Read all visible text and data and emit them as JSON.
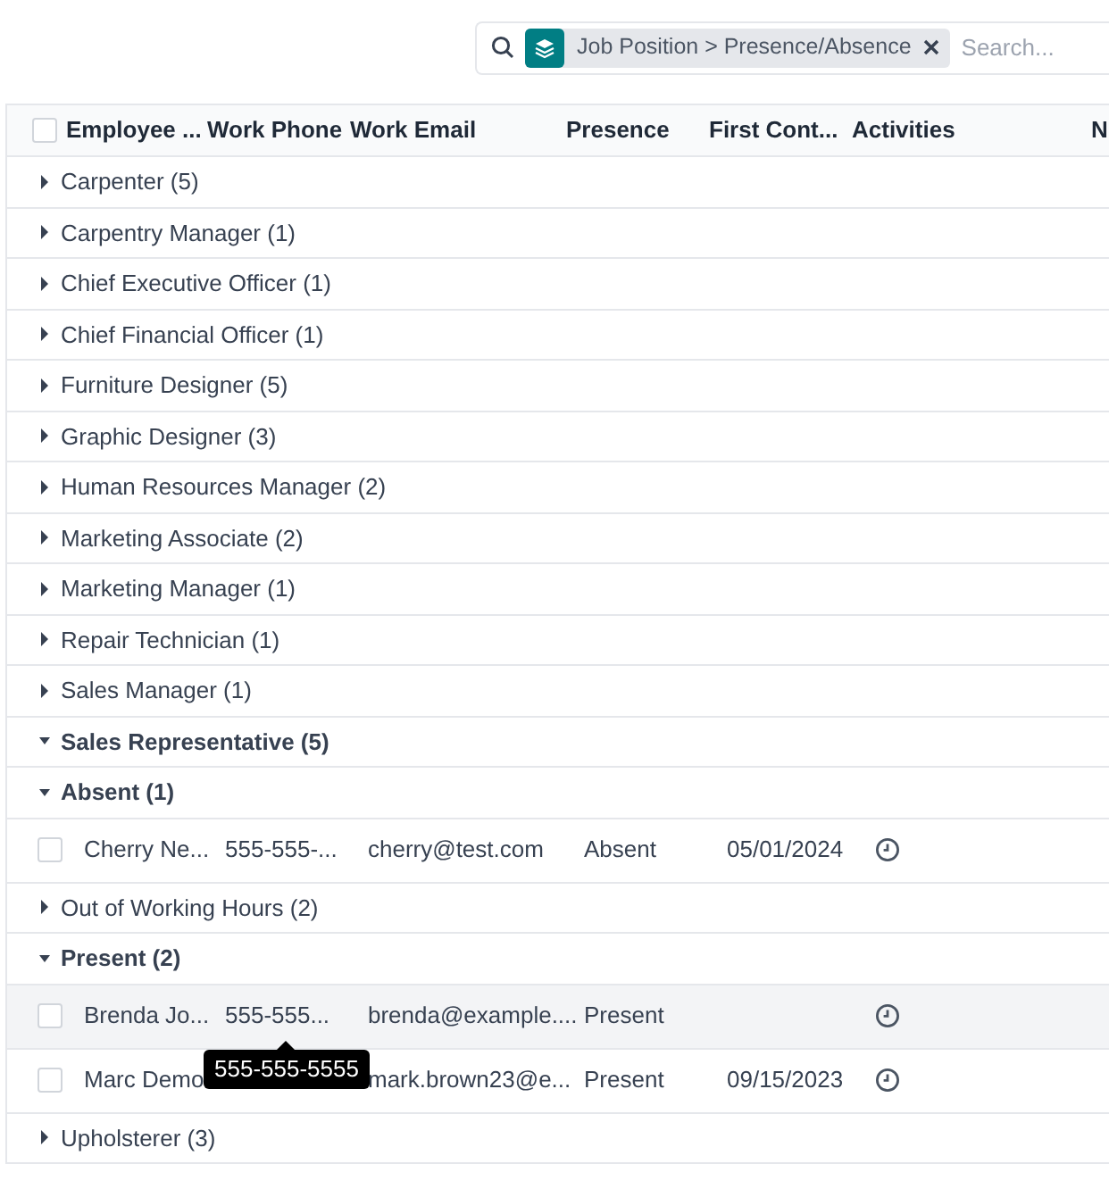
{
  "search": {
    "facet": "Job Position > Presence/Absence",
    "placeholder": "Search..."
  },
  "table": {
    "select_all_checked": false,
    "columns": [
      "Employee ...",
      "Work Phone",
      "Work Email",
      "Presence",
      "First Cont...",
      "Activities",
      "N"
    ],
    "groups": [
      {
        "label": "Carpenter (5)",
        "expanded": false
      },
      {
        "label": "Carpentry Manager (1)",
        "expanded": false
      },
      {
        "label": "Chief Executive Officer (1)",
        "expanded": false
      },
      {
        "label": "Chief Financial Officer (1)",
        "expanded": false
      },
      {
        "label": "Furniture Designer (5)",
        "expanded": false
      },
      {
        "label": "Graphic Designer (3)",
        "expanded": false
      },
      {
        "label": "Human Resources Manager (2)",
        "expanded": false
      },
      {
        "label": "Marketing Associate (2)",
        "expanded": false
      },
      {
        "label": "Marketing Manager (1)",
        "expanded": false
      },
      {
        "label": "Repair Technician (1)",
        "expanded": false
      },
      {
        "label": "Sales Manager (1)",
        "expanded": false
      },
      {
        "label": "Sales Representative (5)",
        "expanded": true,
        "children": [
          {
            "label": "Absent (1)",
            "expanded": true,
            "records": [
              {
                "name": "Cherry Ne...",
                "phone": "555-555-...",
                "email": "cherry@test.com",
                "presence": "Absent",
                "first_contact": "05/01/2024",
                "hovered": false,
                "checked": false
              }
            ]
          },
          {
            "label": "Out of Working Hours (2)",
            "expanded": false
          },
          {
            "label": "Present (2)",
            "expanded": true,
            "records": [
              {
                "name": "Brenda Jo...",
                "phone": "555-555...",
                "email": "brenda@example....",
                "presence": "Present",
                "hovered": true,
                "checked": false,
                "tooltip": "555-555-5555"
              },
              {
                "name": "Marc Demo",
                "email": "mark.brown23@e...",
                "presence": "Present",
                "first_contact": "09/15/2023",
                "hovered": false,
                "checked": false
              }
            ]
          }
        ]
      },
      {
        "label": "Upholsterer (3)",
        "expanded": false
      }
    ]
  }
}
